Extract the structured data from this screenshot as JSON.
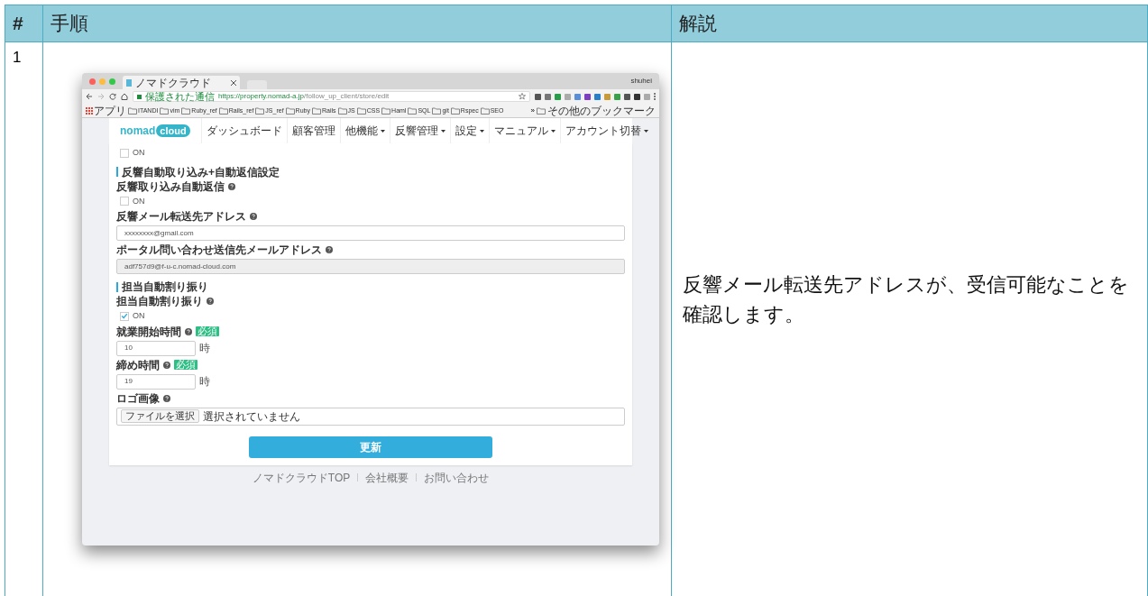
{
  "table": {
    "columns": [
      "#",
      "手順",
      "解説"
    ],
    "rows": [
      {
        "number": "1",
        "description": "反響メール転送先アドレスが、受信可能なことを確認します。",
        "screenshot": {
          "browser": {
            "tab_title": "ノマドクラウド",
            "user": "shuhei",
            "secure_label": "保護された通信",
            "url_host": "https://property.nomad-a.jp",
            "url_path": "/follow_up_client/store/edit",
            "bookmarks": [
              "アプリ",
              "ITANDI",
              "vim",
              "Ruby_ref",
              "Rails_ref",
              "JS_ref",
              "Ruby",
              "Rails",
              "JS",
              "CSS",
              "Haml",
              "SQL",
              "git",
              "Rspec",
              "SEO"
            ],
            "overflow": "»",
            "other_bookmarks": "その他のブックマーク"
          },
          "app": {
            "logo_left": "nomad",
            "logo_right": "cloud",
            "nav": [
              {
                "label": "ダッシュボード",
                "dropdown": false
              },
              {
                "label": "顧客管理",
                "dropdown": false
              },
              {
                "label": "他機能",
                "dropdown": true
              },
              {
                "label": "反響管理",
                "dropdown": true
              },
              {
                "label": "設定",
                "dropdown": true
              },
              {
                "label": "マニュアル",
                "dropdown": true
              },
              {
                "label": "アカウント切替",
                "dropdown": true
              }
            ],
            "form": [
              {
                "kind": "checkbox",
                "label": "ON",
                "checked": false
              },
              {
                "kind": "section",
                "text": "反響自動取り込み+自動返信設定"
              },
              {
                "kind": "label",
                "text": "反響取り込み自動返信"
              },
              {
                "kind": "checkbox",
                "label": "ON",
                "checked": false
              },
              {
                "kind": "label",
                "text": "反響メール転送先アドレス"
              },
              {
                "kind": "input",
                "value": "xxxxxxxx@gmail.com",
                "disabled": false
              },
              {
                "kind": "label",
                "text": "ポータル問い合わせ送信先メールアドレス"
              },
              {
                "kind": "input",
                "value": "adf757d9@f-u-c.nomad-cloud.com",
                "disabled": true
              },
              {
                "kind": "section",
                "text": "担当自動割り振り"
              },
              {
                "kind": "label",
                "text": "担当自動割り振り"
              },
              {
                "kind": "checkbox",
                "label": "ON",
                "checked": true
              },
              {
                "kind": "label",
                "text": "就業開始時間",
                "badge": "必須"
              },
              {
                "kind": "short_input",
                "value": "10",
                "suffix": "時"
              },
              {
                "kind": "label",
                "text": "締め時間",
                "badge": "必須"
              },
              {
                "kind": "short_input",
                "value": "19",
                "suffix": "時"
              },
              {
                "kind": "label",
                "text": "ロゴ画像"
              },
              {
                "kind": "file",
                "button": "ファイルを選択",
                "text": "選択されていません"
              }
            ],
            "submit": "更新",
            "footer_links": [
              "ノマドクラウドTOP",
              "会社概要",
              "お問い合わせ"
            ]
          }
        }
      }
    ]
  }
}
